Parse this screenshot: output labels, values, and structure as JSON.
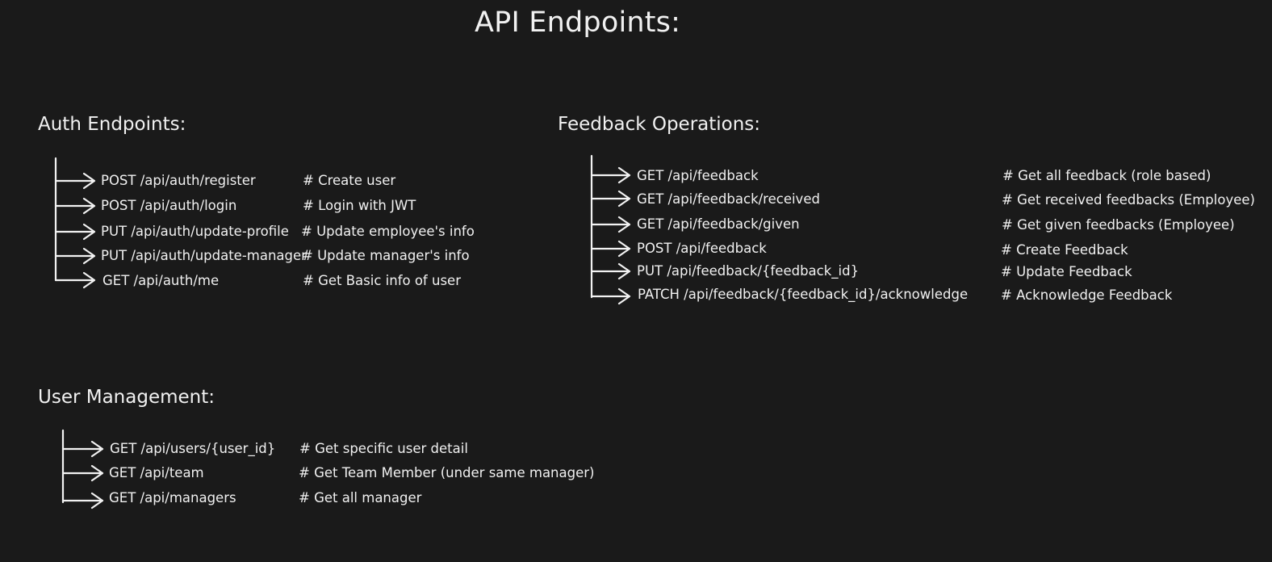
{
  "title": "API Endpoints:",
  "auth": {
    "heading": "Auth Endpoints:",
    "rows": [
      {
        "endpoint": "POST /api/auth/register",
        "comment": "# Create user"
      },
      {
        "endpoint": "POST /api/auth/login",
        "comment": "# Login with JWT"
      },
      {
        "endpoint": "PUT /api/auth/update-profile",
        "comment": "# Update employee's info"
      },
      {
        "endpoint": "PUT /api/auth/update-manager",
        "comment": "# Update manager's info"
      },
      {
        "endpoint": "GET /api/auth/me",
        "comment": "# Get Basic info of user"
      }
    ]
  },
  "feedback": {
    "heading": "Feedback Operations:",
    "rows": [
      {
        "endpoint": "GET /api/feedback",
        "comment": "# Get all feedback (role based)"
      },
      {
        "endpoint": "GET /api/feedback/received",
        "comment": "# Get received feedbacks (Employee)"
      },
      {
        "endpoint": "GET /api/feedback/given",
        "comment": "# Get given feedbacks (Employee)"
      },
      {
        "endpoint": "POST /api/feedback",
        "comment": "# Create Feedback"
      },
      {
        "endpoint": "PUT /api/feedback/{feedback_id}",
        "comment": "# Update Feedback"
      },
      {
        "endpoint": "PATCH /api/feedback/{feedback_id}/acknowledge",
        "comment": "# Acknowledge Feedback"
      }
    ]
  },
  "users": {
    "heading": "User Management:",
    "rows": [
      {
        "endpoint": "GET /api/users/{user_id}",
        "comment": "# Get specific user detail"
      },
      {
        "endpoint": "GET /api/team",
        "comment": "# Get Team Member (under same manager)"
      },
      {
        "endpoint": "GET /api/managers",
        "comment": "# Get all manager"
      }
    ]
  }
}
